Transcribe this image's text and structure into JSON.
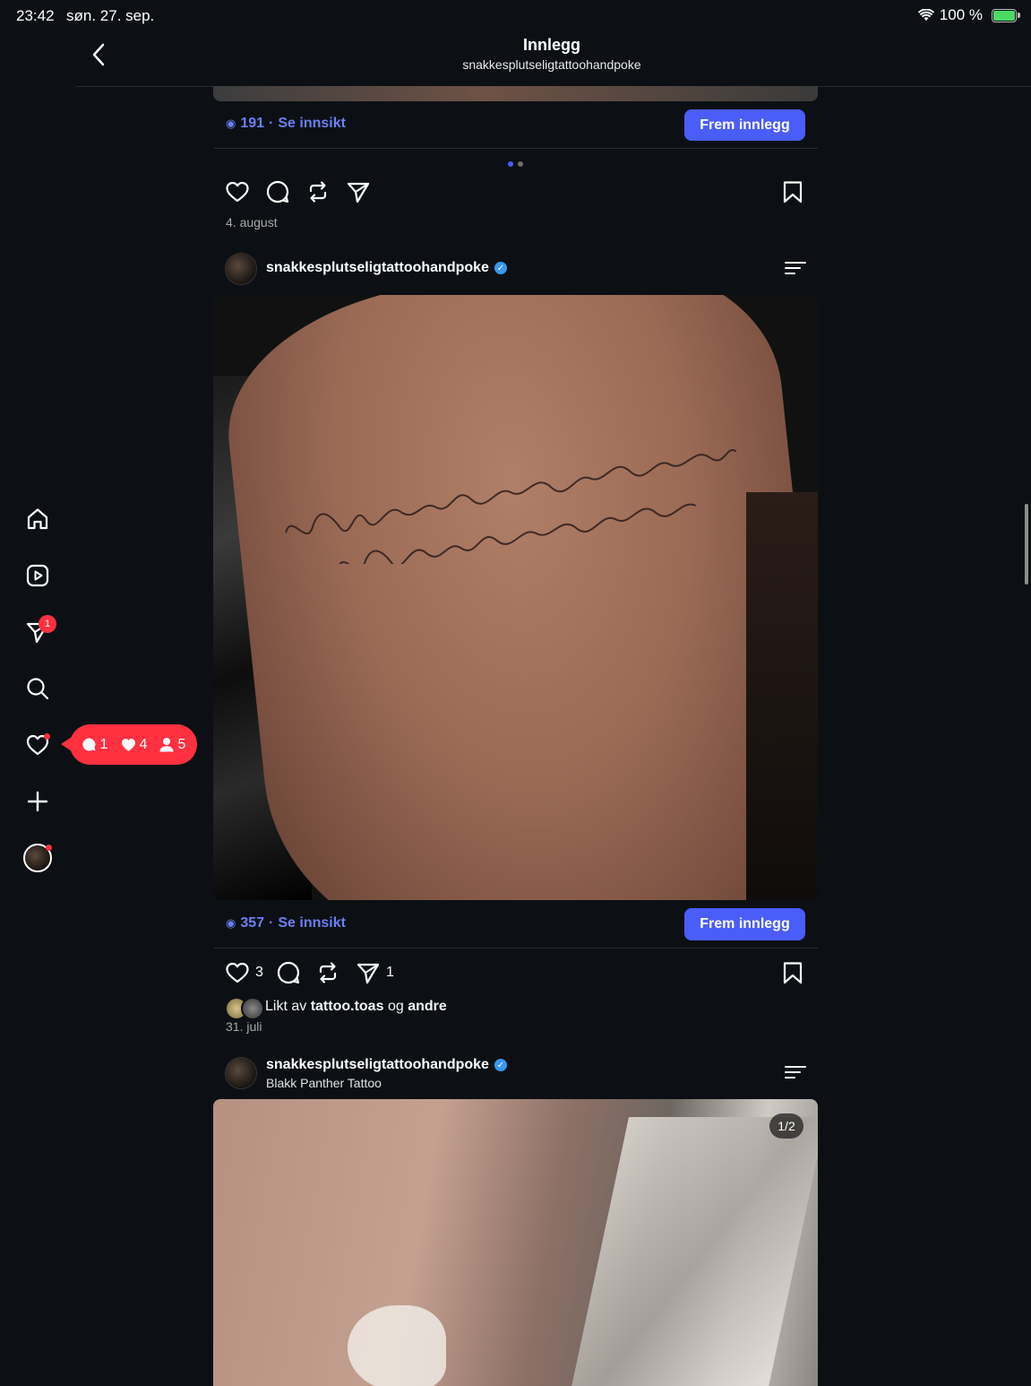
{
  "status_bar": {
    "time": "23:42",
    "date": "søn. 27. sep.",
    "battery": "100 %"
  },
  "header": {
    "title": "Innlegg",
    "subtitle": "snakkesplutseligtattoohandpoke"
  },
  "nav": {
    "items": [
      "home-icon",
      "reels-icon",
      "direct-icon",
      "search-icon",
      "heart-icon",
      "create-icon",
      "profile-avatar"
    ],
    "direct_badge": "1",
    "notifications": {
      "comments": "1",
      "likes": "4",
      "follows": "5"
    }
  },
  "post1": {
    "views": "191",
    "insight_link": "Se innsikt",
    "promote_label": "Frem innlegg",
    "carousel_dots": 2,
    "date": "4. august"
  },
  "post2": {
    "username": "snakkesplutseligtattoohandpoke",
    "views": "357",
    "insight_link": "Se innsikt",
    "promote_label": "Frem innlegg",
    "like_count": "3",
    "share_count": "1",
    "likes_prefix": "Likt av",
    "liked_by": "tattoo.toas",
    "likes_joiner": "og",
    "liked_others": "andre",
    "date": "31. juli"
  },
  "post3": {
    "username": "snakkesplutseligtattoohandpoke",
    "location": "Blakk Panther Tattoo",
    "media_counter": "1/2"
  },
  "colors": {
    "background": "#0c1014",
    "accent": "#4a5df9",
    "link": "#6b7ff5",
    "badge": "#ff3040",
    "verified": "#3897f0"
  }
}
